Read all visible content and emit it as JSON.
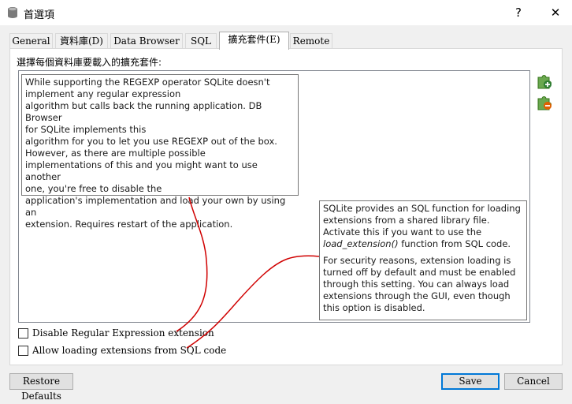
{
  "window": {
    "title": "首選項",
    "help_label": "?",
    "close_label": "✕"
  },
  "tabs": [
    {
      "label": "General"
    },
    {
      "label": "資料庫(D)"
    },
    {
      "label": "Data Browser"
    },
    {
      "label": "SQL"
    },
    {
      "label": "擴充套件(E)"
    },
    {
      "label": "Remote"
    }
  ],
  "extensions": {
    "label": "選擇每個資料庫要載入的擴充套件:",
    "add_icon": "extension-add-icon",
    "remove_icon": "extension-remove-icon"
  },
  "tooltip_regexp": {
    "lines": [
      "While supporting the REGEXP operator SQLite doesn't",
      "implement any regular expression",
      "algorithm but calls back the running application. DB Browser",
      "for SQLite implements this",
      "algorithm for you to let you use REGEXP out of the box.",
      "However, as there are multiple possible",
      "implementations of this and you might want to use another",
      "one, you're free to disable the",
      "application's implementation and load your own by using an",
      "extension. Requires restart of the application."
    ]
  },
  "tooltip_loadext": {
    "para1_before": "SQLite provides an SQL function for loading extensions from a shared library file. Activate this if you want to use the ",
    "para1_func": "load_extension()",
    "para1_after": " function from SQL code.",
    "para2": "For security reasons, extension loading is turned off by default and must be enabled through this setting. You can always load extensions through the GUI, even though this option is disabled."
  },
  "options": {
    "disable_regex": {
      "label": "Disable Regular Expression extension",
      "checked": false
    },
    "allow_loading": {
      "label": "Allow loading extensions from SQL code",
      "checked": false
    }
  },
  "buttons": {
    "restore": "Restore Defaults",
    "save": "Save",
    "cancel": "Cancel"
  },
  "colors": {
    "annotation": "#d00000",
    "default_button_border": "#0078d7"
  }
}
